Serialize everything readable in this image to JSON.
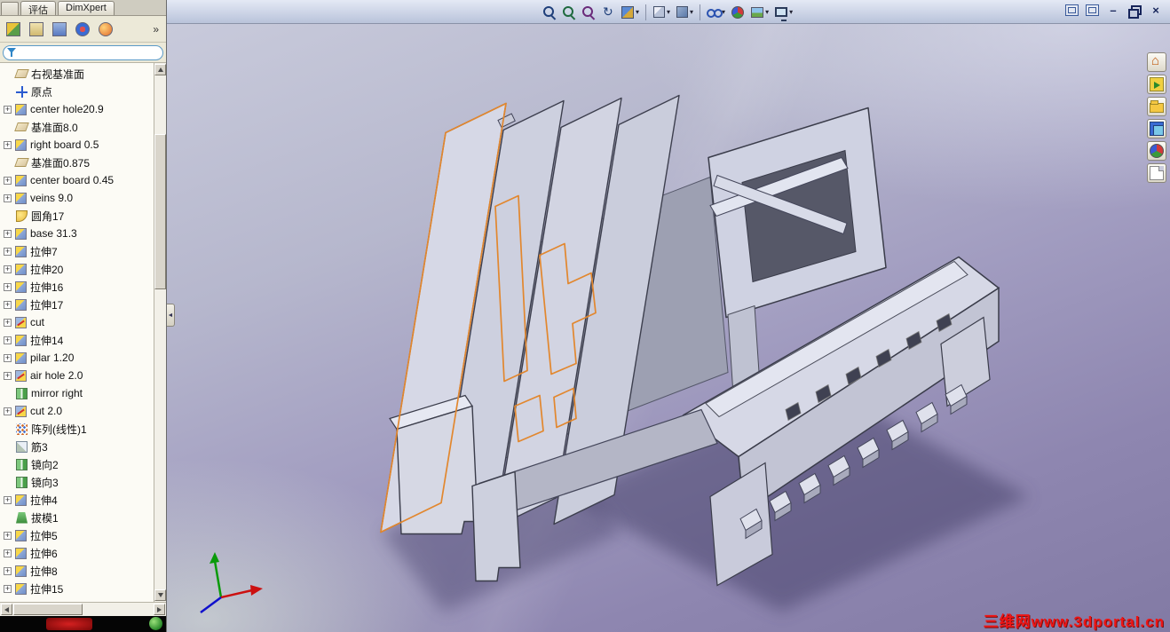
{
  "command_manager": {
    "tabs": [
      {
        "label": "评估"
      },
      {
        "label": "DimXpert"
      }
    ]
  },
  "manager_pane": {
    "tab_icons": [
      {
        "name": "featuremanager-tab"
      },
      {
        "name": "propertymanager-tab"
      },
      {
        "name": "configurationmanager-tab"
      },
      {
        "name": "dimxpertmanager-tab"
      },
      {
        "name": "displaymanager-tab"
      }
    ],
    "overflow_label": "»"
  },
  "feature_tree": {
    "expander_glyph": "+",
    "items": [
      {
        "label": "右视基准面",
        "icon": "datum-plane",
        "expandable": false
      },
      {
        "label": "原点",
        "icon": "origin",
        "expandable": false
      },
      {
        "label": "center hole20.9",
        "icon": "extrude",
        "expandable": true
      },
      {
        "label": "基准面8.0",
        "icon": "datum-plane",
        "expandable": false
      },
      {
        "label": "right board 0.5",
        "icon": "extrude",
        "expandable": true
      },
      {
        "label": "基准面0.875",
        "icon": "datum-plane",
        "expandable": false
      },
      {
        "label": "center board 0.45",
        "icon": "extrude",
        "expandable": true
      },
      {
        "label": "veins 9.0",
        "icon": "extrude",
        "expandable": true
      },
      {
        "label": "圆角17",
        "icon": "fillet",
        "expandable": false
      },
      {
        "label": "base 31.3",
        "icon": "extrude",
        "expandable": true
      },
      {
        "label": "拉伸7",
        "icon": "extrude",
        "expandable": true
      },
      {
        "label": "拉伸20",
        "icon": "extrude",
        "expandable": true
      },
      {
        "label": "拉伸16",
        "icon": "extrude",
        "expandable": true
      },
      {
        "label": "拉伸17",
        "icon": "extrude",
        "expandable": true
      },
      {
        "label": "cut",
        "icon": "cut",
        "expandable": true
      },
      {
        "label": "拉伸14",
        "icon": "extrude",
        "expandable": true
      },
      {
        "label": "pilar 1.20",
        "icon": "extrude",
        "expandable": true
      },
      {
        "label": "air hole 2.0",
        "icon": "cut",
        "expandable": true
      },
      {
        "label": "mirror right",
        "icon": "mirror",
        "expandable": false
      },
      {
        "label": "cut  2.0",
        "icon": "cut",
        "expandable": true
      },
      {
        "label": "阵列(线性)1",
        "icon": "pattern",
        "expandable": false
      },
      {
        "label": "筋3",
        "icon": "rib",
        "expandable": false
      },
      {
        "label": "镜向2",
        "icon": "mirror",
        "expandable": false
      },
      {
        "label": "镜向3",
        "icon": "mirror",
        "expandable": false
      },
      {
        "label": "拉伸4",
        "icon": "extrude",
        "expandable": true
      },
      {
        "label": "拔模1",
        "icon": "draft",
        "expandable": false
      },
      {
        "label": "拉伸5",
        "icon": "extrude",
        "expandable": true
      },
      {
        "label": "拉伸6",
        "icon": "extrude",
        "expandable": true
      },
      {
        "label": "拉伸8",
        "icon": "extrude",
        "expandable": true
      },
      {
        "label": "拉伸15",
        "icon": "extrude",
        "expandable": true
      }
    ]
  },
  "view_toolbar": {
    "caret": "▾",
    "buttons": [
      {
        "name": "zoom-to-fit",
        "dropdown": false,
        "divider_after": false
      },
      {
        "name": "zoom-to-area",
        "dropdown": false,
        "divider_after": false
      },
      {
        "name": "zoom-in-out",
        "dropdown": false,
        "divider_after": false
      },
      {
        "name": "rotate-view",
        "dropdown": false,
        "divider_after": false
      },
      {
        "name": "section-view",
        "dropdown": true,
        "divider_after": true
      },
      {
        "name": "view-orientation",
        "dropdown": true,
        "divider_after": false
      },
      {
        "name": "display-style",
        "dropdown": true,
        "divider_after": true
      },
      {
        "name": "hide-show-items",
        "dropdown": true,
        "divider_after": false
      },
      {
        "name": "edit-appearance",
        "dropdown": false,
        "divider_after": false
      },
      {
        "name": "apply-scene",
        "dropdown": true,
        "divider_after": false
      },
      {
        "name": "view-settings",
        "dropdown": true,
        "divider_after": false
      }
    ]
  },
  "window_controls": {
    "minimize_glyph": "–",
    "close_glyph": "×"
  },
  "right_toolbar": {
    "buttons": [
      {
        "name": "home"
      },
      {
        "name": "whats-new"
      },
      {
        "name": "open-folder"
      },
      {
        "name": "displays"
      },
      {
        "name": "web"
      },
      {
        "name": "document"
      }
    ]
  },
  "viewport": {
    "watermark": "三维网www.3dportal.cn",
    "collapse_arrow": "◄"
  },
  "colors": {
    "sketch_orange": "#e2872e",
    "model_light": "#d6d8e6",
    "model_mid": "#c2c4d4",
    "model_dark": "#565868",
    "shadow": "#433c66",
    "watermark_red": "#ee1515"
  }
}
